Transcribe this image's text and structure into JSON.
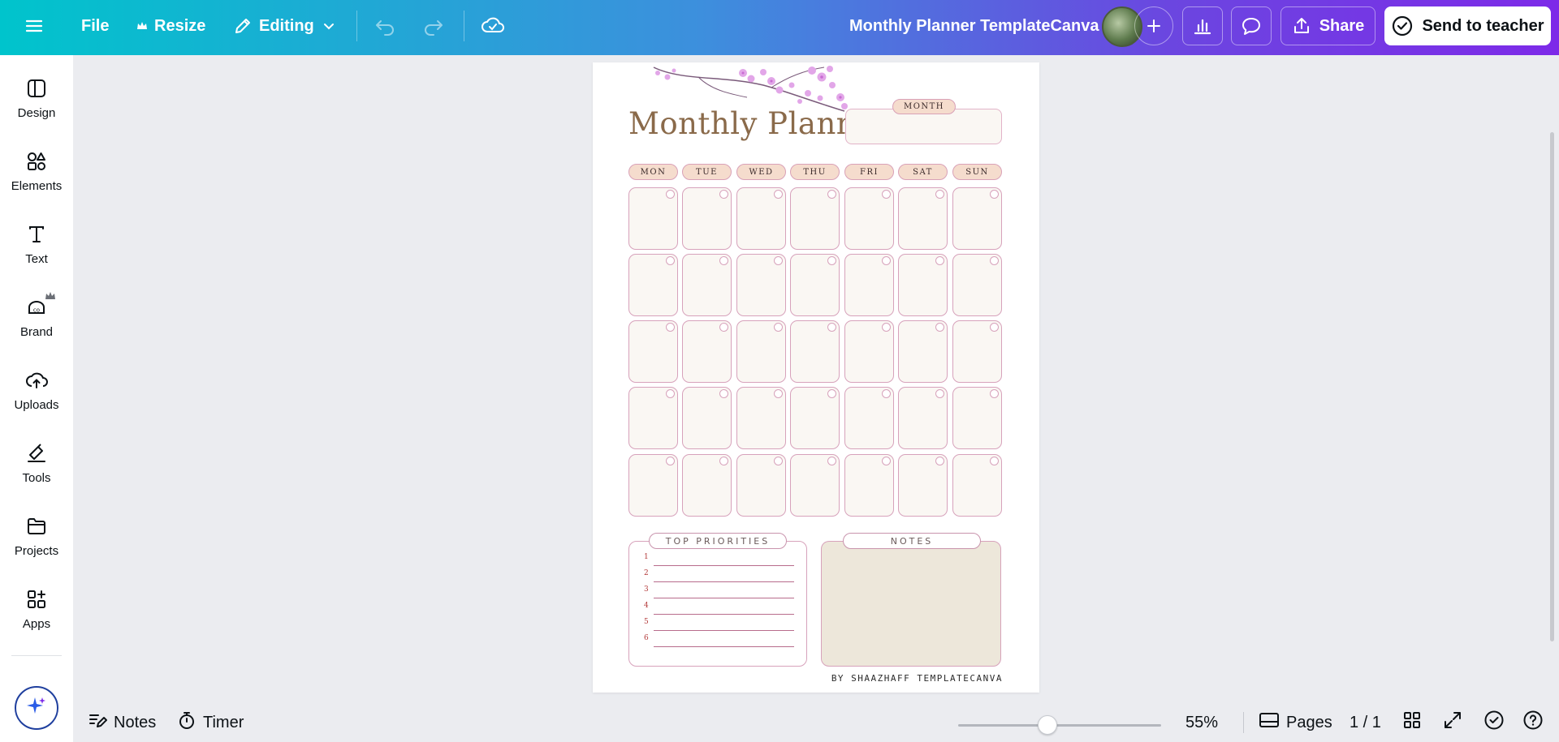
{
  "topbar": {
    "file_label": "File",
    "resize_label": "Resize",
    "editing_label": "Editing",
    "doc_title": "Monthly Planner TemplateCanva",
    "share_label": "Share",
    "teacher_label": "Send to teacher"
  },
  "sidebar": {
    "items": [
      {
        "label": "Design",
        "icon": "design-icon"
      },
      {
        "label": "Elements",
        "icon": "elements-icon"
      },
      {
        "label": "Text",
        "icon": "text-icon"
      },
      {
        "label": "Brand",
        "icon": "brand-icon"
      },
      {
        "label": "Uploads",
        "icon": "uploads-icon"
      },
      {
        "label": "Tools",
        "icon": "tools-icon"
      },
      {
        "label": "Projects",
        "icon": "projects-icon"
      },
      {
        "label": "Apps",
        "icon": "apps-icon"
      }
    ]
  },
  "planner": {
    "title": "Monthly Planner",
    "month_label": "MONTH",
    "days": [
      "MON",
      "TUE",
      "WED",
      "THU",
      "FRI",
      "SAT",
      "SUN"
    ],
    "priorities_label": "TOP PRIORITIES",
    "priority_numbers": [
      "1",
      "2",
      "3",
      "4",
      "5",
      "6"
    ],
    "notes_label": "NOTES",
    "byline": "BY SHAAZHAFF TEMPLATECANVA"
  },
  "bottombar": {
    "notes_label": "Notes",
    "timer_label": "Timer",
    "zoom_level": "55%",
    "zoom_fraction": 0.45,
    "pages_label": "Pages",
    "page_count": "1 / 1"
  },
  "colors": {
    "accent_purple": "#7d2ae8",
    "accent_teal": "#00c4cc",
    "planner_pink": "#d7a2bb",
    "planner_brown": "#8a6a4a"
  }
}
